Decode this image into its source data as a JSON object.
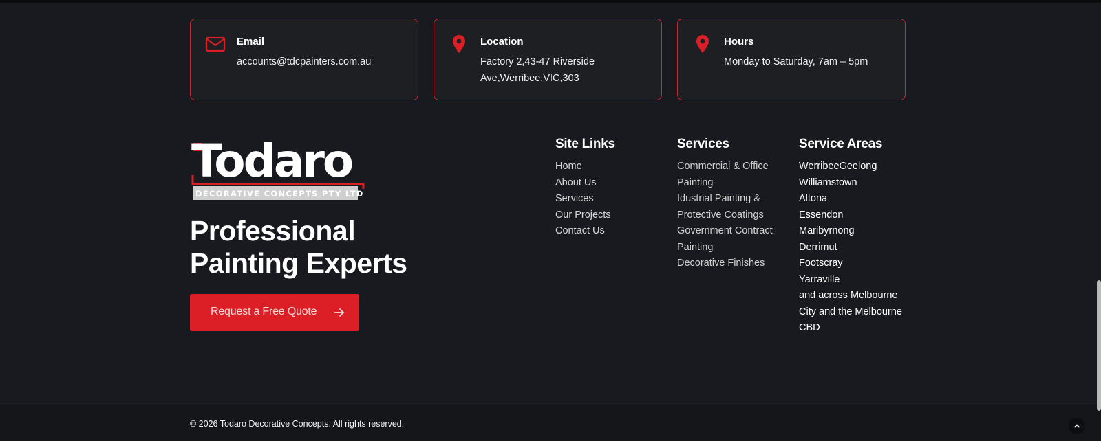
{
  "colors": {
    "accent": "#dc1f26",
    "background": "#191a1f",
    "card_border": "#d9232d"
  },
  "contact_cards": {
    "email": {
      "icon": "mail-icon",
      "title": "Email",
      "value": "accounts@tdcpainters.com.au"
    },
    "location": {
      "icon": "map-pin-icon",
      "title": "Location",
      "value": "Factory 2,43-47 Riverside Ave,Werribee,VIC,303"
    },
    "hours": {
      "icon": "map-pin-icon",
      "title": "Hours",
      "value": "Monday to Saturday, 7am – 5pm"
    }
  },
  "logo": {
    "wordmark": "Todaro",
    "subtitle": "DECORATIVE CONCEPTS PTY LTD"
  },
  "tagline": "Professional Painting Experts",
  "cta": {
    "label": "Request a Free Quote",
    "icon": "arrow-right-icon"
  },
  "site_links": {
    "heading": "Site Links",
    "items": [
      "Home",
      "About Us",
      "Services",
      "Our Projects",
      "Contact Us"
    ]
  },
  "services": {
    "heading": "Services",
    "items": [
      "Commercial & Office Painting",
      "Idustrial Painting & Protective Coatings",
      "Government Contract Painting",
      "Decorative Finishes"
    ]
  },
  "service_areas": {
    "heading": "Service Areas",
    "items": [
      "WerribeeGeelong",
      "Williamstown",
      "Altona",
      "Essendon",
      "Maribyrnong",
      "Derrimut",
      "Footscray",
      "Yarraville",
      "and across Melbourne City and the Melbourne CBD"
    ]
  },
  "footer": {
    "copyright": "© 2026 Todaro Decorative Concepts. All rights reserved.",
    "scroll_top_icon": "chevron-up-icon"
  }
}
